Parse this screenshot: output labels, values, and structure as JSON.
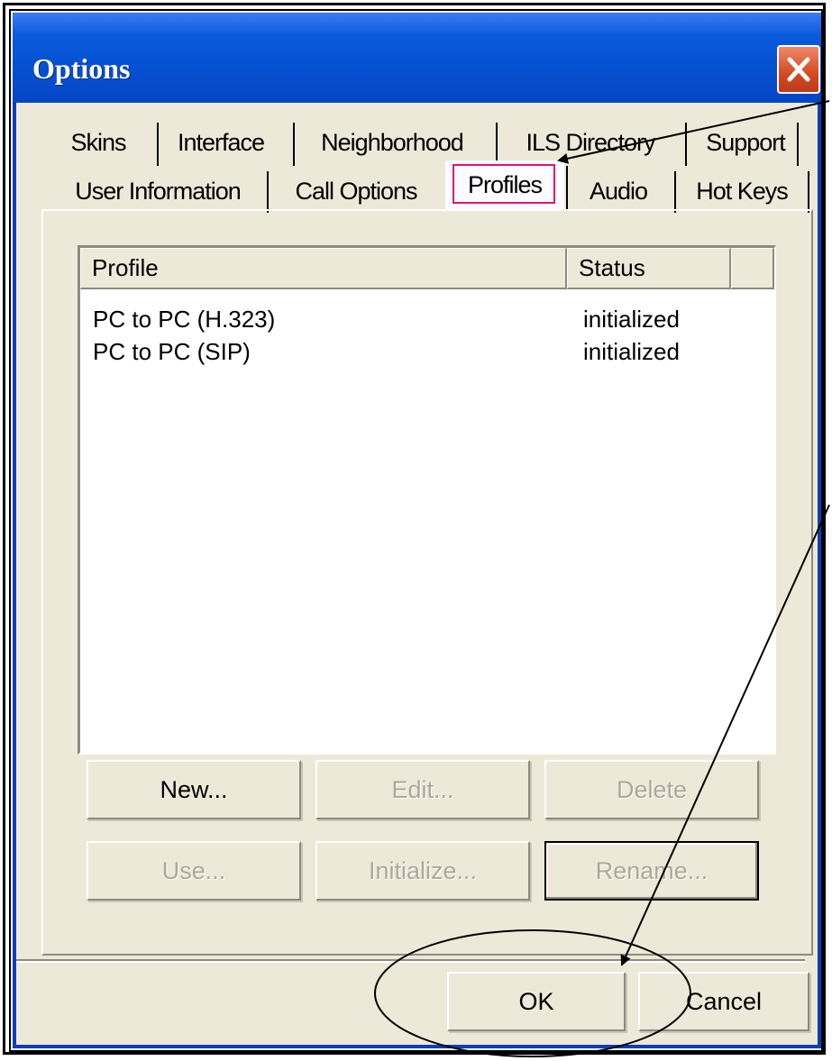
{
  "window": {
    "title": "Options",
    "close_icon": "close-icon"
  },
  "tabs": {
    "row1": [
      {
        "label": "Skins"
      },
      {
        "label": "Interface"
      },
      {
        "label": "Neighborhood"
      },
      {
        "label": "ILS Directory"
      },
      {
        "label": "Support"
      }
    ],
    "row2": [
      {
        "label": "User Information"
      },
      {
        "label": "Call Options"
      },
      {
        "label": "Profiles"
      },
      {
        "label": "Audio"
      },
      {
        "label": "Hot Keys"
      }
    ],
    "active": "Profiles"
  },
  "profiles_list": {
    "columns": [
      "Profile",
      "Status"
    ],
    "rows": [
      {
        "profile": "PC to PC (H.323)",
        "status": "initialized"
      },
      {
        "profile": "PC to PC (SIP)",
        "status": "initialized"
      }
    ]
  },
  "buttons": {
    "new": "New...",
    "edit": "Edit...",
    "delete": "Delete",
    "use": "Use...",
    "initialize": "Initialize...",
    "rename": "Rename...",
    "ok": "OK",
    "cancel": "Cancel"
  },
  "colors": {
    "titlebar": "#0550d2",
    "highlight": "#e0127a",
    "face": "#ece9d8"
  }
}
